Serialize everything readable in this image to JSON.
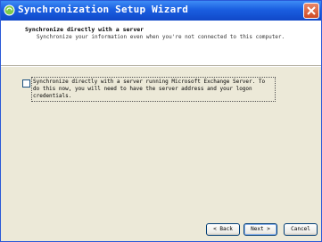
{
  "window": {
    "title": "Synchronization Setup Wizard",
    "icons": {
      "app": "sync-app-icon",
      "close": "close-icon"
    }
  },
  "header": {
    "title": "Synchronize directly with a server",
    "description": "Synchronize your information even when you're not connected to this computer."
  },
  "option": {
    "checked": false,
    "label": "Synchronize directly with a server running Microsoft Exchange Server. To do this now, you will need to have the server address and your logon credentials."
  },
  "buttons": {
    "back": "< Back",
    "next": "Next >",
    "cancel": "Cancel"
  },
  "colors": {
    "titlebar": "#1a5ee0",
    "dialog_bg": "#ece9d8",
    "close": "#d14a24"
  }
}
